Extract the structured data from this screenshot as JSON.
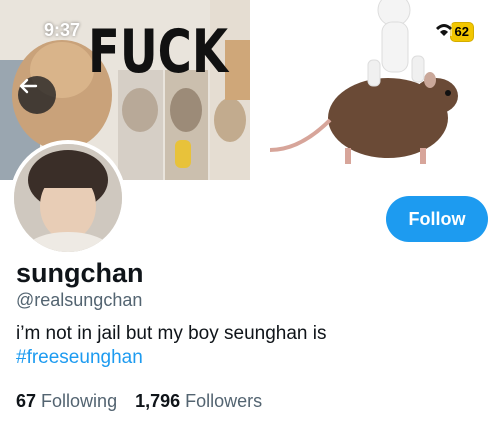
{
  "status_bar": {
    "time": "9:37",
    "battery": "62"
  },
  "header": {
    "banner_text": "FUCK"
  },
  "profile": {
    "follow_label": "Follow",
    "display_name": "sungchan",
    "handle": "@realsungchan",
    "bio": "i’m not in jail but my boy seunghan is",
    "hashtag": "#freeseunghan",
    "following_count": "67",
    "following_label": "Following",
    "followers_count": "1,796",
    "followers_label": "Followers"
  },
  "colors": {
    "accent": "#1d9bf0",
    "text": "#0f1419",
    "muted": "#536471"
  },
  "icons": [
    "back-arrow-icon",
    "signal-icon",
    "wifi-icon",
    "battery-icon"
  ]
}
